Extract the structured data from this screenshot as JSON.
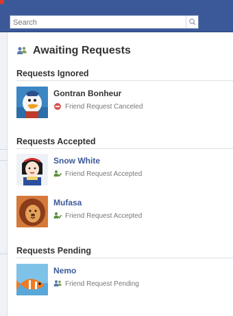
{
  "search": {
    "placeholder": "Search"
  },
  "page": {
    "title": "Awaiting Requests"
  },
  "sections": [
    {
      "title": "Requests Ignored",
      "items": [
        {
          "name": "Gontran Bonheur",
          "status": "Friend Request Canceled",
          "status_icon": "blocked-icon",
          "avatar": "duck-avatar"
        }
      ]
    },
    {
      "title": "Requests Accepted",
      "items": [
        {
          "name": "Snow White",
          "status": "Friend Request Accepted",
          "status_icon": "friend-accepted-icon",
          "avatar": "snow-white-avatar"
        },
        {
          "name": "Mufasa",
          "status": "Friend Request Accepted",
          "status_icon": "friend-accepted-icon",
          "avatar": "lion-avatar"
        }
      ]
    },
    {
      "title": "Requests Pending",
      "items": [
        {
          "name": "Nemo",
          "status": "Friend Request Pending",
          "status_icon": "friend-pending-icon",
          "avatar": "fish-avatar"
        }
      ]
    }
  ],
  "colors": {
    "topbar": "#3b5998",
    "link": "#3b5998",
    "canceled": "#d9534f",
    "accepted": "#5a8f3c",
    "pending": "#5b79b4"
  }
}
